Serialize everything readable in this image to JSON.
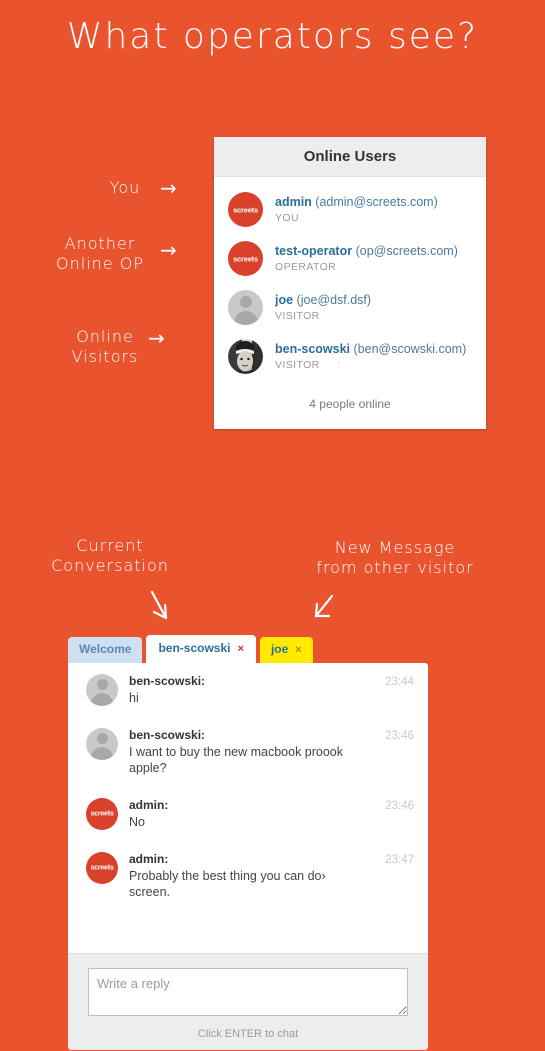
{
  "page": {
    "title": "What operators see?",
    "background_color": "#e9542f"
  },
  "annotations": {
    "you": "You",
    "another_online_op": "Another\nOnline OP",
    "online_visitors": "Online\nVisitors",
    "current_conversation": "Current\nConversation",
    "new_message": "New Message\nfrom other visitor",
    "arrow_right_glyph": "→"
  },
  "online_users": {
    "header": "Online Users",
    "footer": "4 people online",
    "users": [
      {
        "name": "admin",
        "email": "(admin@screets.com)",
        "role": "YOU",
        "role_extra": "",
        "avatar": "screets-avatar",
        "avatar_text": "screets"
      },
      {
        "name": "test-operator",
        "email": "(op@screets.com)",
        "role": "OPERATOR",
        "role_extra": "",
        "avatar": "screets-avatar",
        "avatar_text": "screets"
      },
      {
        "name": "joe",
        "email": "(joe@dsf.dsf)",
        "role": "VISITOR",
        "role_extra": "",
        "avatar": "default-person-avatar",
        "avatar_text": ""
      },
      {
        "name": "ben-scowski",
        "email": "(ben@scowski.com)",
        "role": "VISITOR",
        "role_extra": ":",
        "avatar": "photo-avatar",
        "avatar_text": ""
      }
    ]
  },
  "chat": {
    "tabs": [
      {
        "label": "Welcome",
        "closable": false,
        "state": "inactive"
      },
      {
        "label": "ben-scowski",
        "closable": true,
        "state": "active",
        "close_glyph": "×"
      },
      {
        "label": "joe",
        "closable": true,
        "state": "alert",
        "close_glyph": "×"
      }
    ],
    "messages": [
      {
        "author": "ben-scowski:",
        "text": "hi",
        "time": "23:44",
        "avatar": "default-person-avatar",
        "avatar_text": ""
      },
      {
        "author": "ben-scowski:",
        "text": "I want to buy the new macbook proook apple?",
        "time": "23:46",
        "avatar": "default-person-avatar",
        "avatar_text": ""
      },
      {
        "author": "admin:",
        "text": "No",
        "time": "23:46",
        "avatar": "screets-avatar",
        "avatar_text": "screets"
      },
      {
        "author": "admin:",
        "text": "Probably the best thing you can do› screen.",
        "time": "23:47",
        "avatar": "screets-avatar",
        "avatar_text": "screets"
      }
    ],
    "reply": {
      "placeholder": "Write a reply",
      "value": "",
      "hint": "Click ENTER to chat"
    }
  },
  "colors": {
    "accent": "#e9542f",
    "avatar_red": "#d9412a",
    "tab_alert": "#ffeb00",
    "tab_inactive": "#cfe0f2",
    "link_blue": "#2b6e9e"
  }
}
